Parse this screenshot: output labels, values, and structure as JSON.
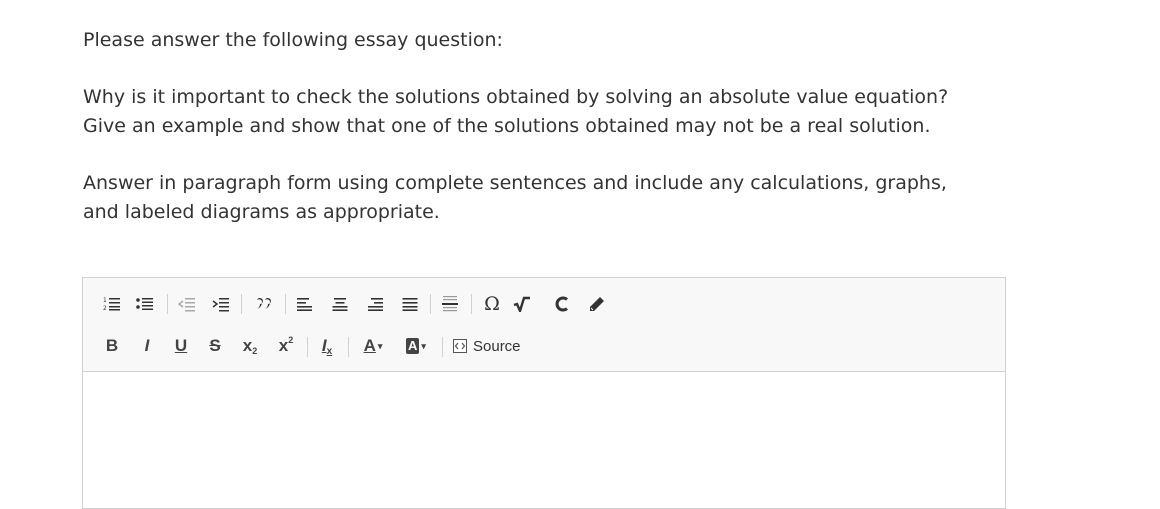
{
  "intro": "Please answer the following essay question:",
  "question": {
    "line1": "Why is it important to check the solutions obtained by solving an absolute value equation?",
    "line2": "Give an example and show that one of the solutions obtained may not be a real solution."
  },
  "instructions": {
    "line1": "Answer in paragraph form using complete sentences and include any calculations, graphs,",
    "line2": "and labeled diagrams as appropriate."
  },
  "toolbar": {
    "row1": [
      "numbered-list-icon",
      "bulleted-list-icon",
      "decrease-indent-icon",
      "increase-indent-icon",
      "blockquote-icon",
      "align-left-icon",
      "align-center-icon",
      "align-right-icon",
      "justify-icon",
      "horizontal-line-icon",
      "special-character-icon",
      "math-icon",
      "copy-format-icon",
      "pencil-icon"
    ],
    "bold_label": "B",
    "italic_label": "I",
    "underline_label": "U",
    "strike_label": "S",
    "subscript_label": "x",
    "superscript_label": "x",
    "remove_format_label": "I",
    "text_color_label": "A",
    "bg_color_label": "A",
    "source_label": "Source"
  },
  "editor": {
    "content": ""
  }
}
